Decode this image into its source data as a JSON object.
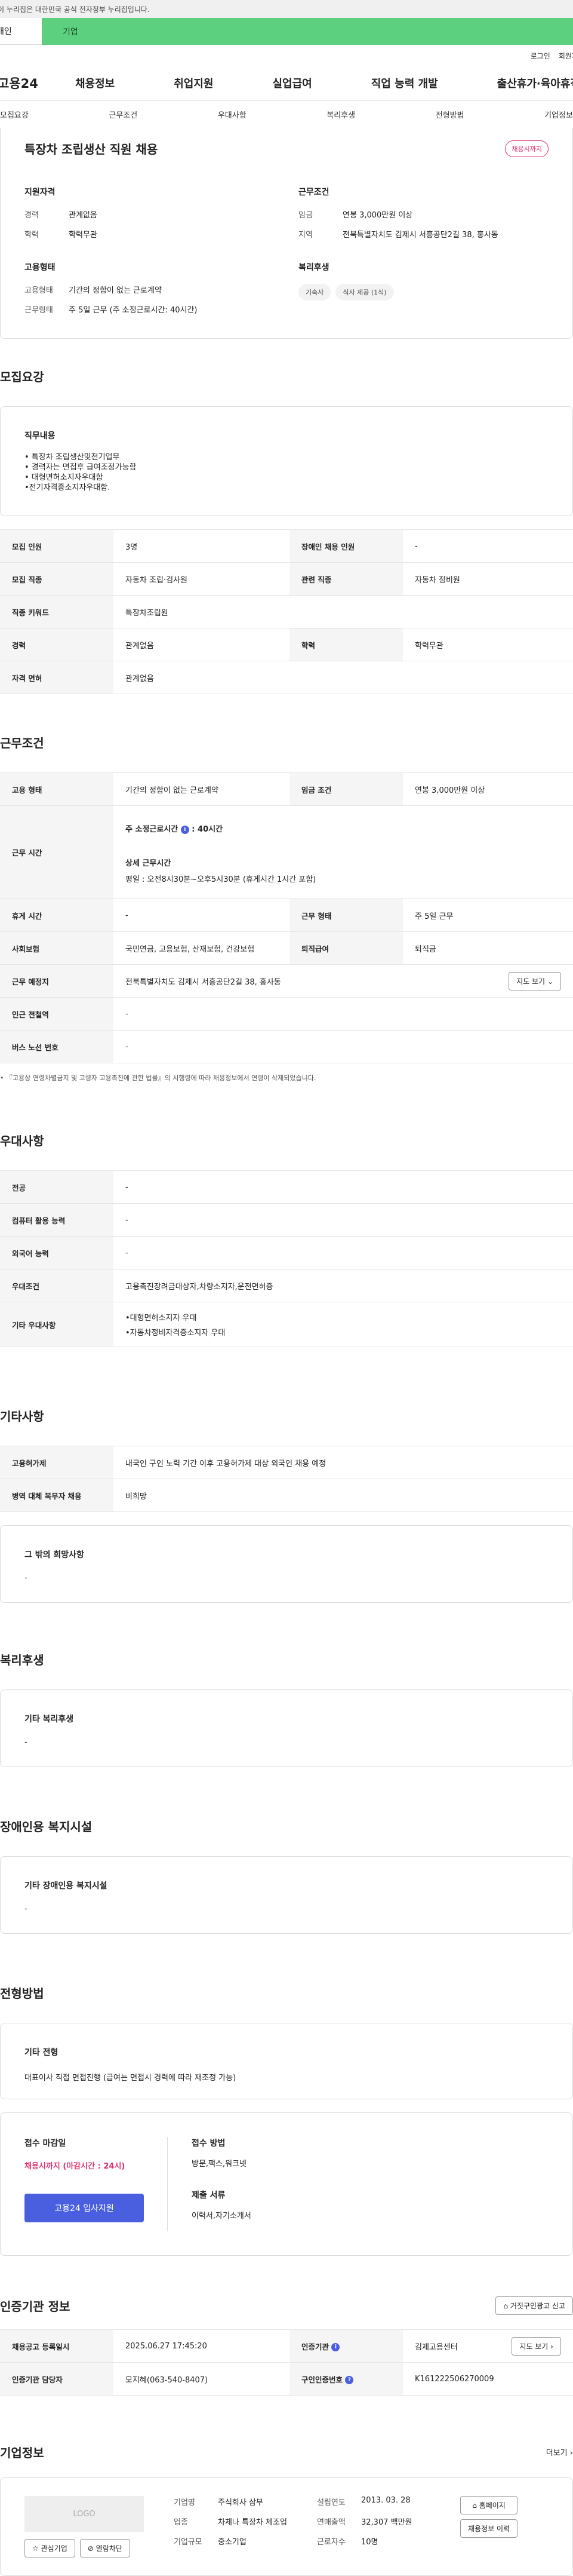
{
  "gov_banner": "이 누리집은 대한민국 공식 전자정부 누리집입니다.",
  "tabs": {
    "personal": "개인",
    "company": "기업"
  },
  "util": [
    "로그인",
    "회원가입"
  ],
  "logo": "고용24",
  "gnb": [
    "채용정보",
    "취업지원",
    "실업급여",
    "직업 능력 개발",
    "출산휴가·육아휴직"
  ],
  "anchor": [
    "모집요강",
    "근무조건",
    "우대사항",
    "복리후생",
    "전형방법",
    "기업정보"
  ],
  "job": {
    "title": "특장차 조립생산 직원 채용",
    "badge": "채용시까지",
    "qual": {
      "h": "지원자격",
      "exp_k": "경력",
      "exp_v": "관계없음",
      "edu_k": "학력",
      "edu_v": "학력무관"
    },
    "cond": {
      "h": "근무조건",
      "pay_k": "임금",
      "pay_v": "연봉 3,000만원 이상",
      "loc_k": "지역",
      "loc_v": "전북특별자치도 김제시 서흥공단2길 38, 홍사동"
    },
    "emp": {
      "h": "고용형태",
      "type_k": "고용형태",
      "type_v": "기간의 정함이 없는 근로계약",
      "form_k": "근무형태",
      "form_v": "주 5일 근무 (주 소정근로시간: 40시간)"
    },
    "welfare": {
      "h": "복리후생",
      "chips": [
        "기숙사",
        "식사 제공 (1식)"
      ]
    }
  },
  "recruit": {
    "title": "모집요강",
    "duty_h": "직무내용",
    "duty": [
      "• 특장차 조립생산및전기업무",
      "• 경력자는 면접후 급여조정가능함",
      "• 대형면허소지자우대함",
      "•전기자격증소지자우대함."
    ],
    "rows": [
      [
        "모집 인원",
        "3명",
        "장애인 채용 인원",
        "-"
      ],
      [
        "모집 직종",
        "자동차 조립·검사원",
        "관련 직종",
        "자동차 정비원"
      ],
      [
        "직종 키워드",
        "특장차조립원"
      ],
      [
        "경력",
        "관계없음",
        "학력",
        "학력무관"
      ],
      [
        "자격 면허",
        "관계없음"
      ]
    ]
  },
  "work": {
    "title": "근무조건",
    "r1": [
      "고용 형태",
      "기간의 정함이 없는 근로계약",
      "임금 조건",
      "연봉 3,000만원 이상"
    ],
    "hours_k": "근무 시간",
    "hours_main": "주 소정근로시간",
    "hours_val": "40시간",
    "hours_detail_h": "상세 근무시간",
    "hours_detail": "평일 : 오전8시30분~오후5시30분 (휴게시간 1시간 포함)",
    "r2": [
      "휴게 시간",
      "-",
      "근무 형태",
      "주 5일 근무"
    ],
    "r3": [
      "사회보험",
      "국민연금, 고용보험, 산재보험, 건강보험",
      "퇴직급여",
      "퇴직금"
    ],
    "place_k": "근무 예정지",
    "place_v": "전북특별자치도 김제시 서흥공단2길 38, 홍사동",
    "map_btn": "지도 보기",
    "r4": [
      "인근 전철역",
      "-"
    ],
    "r5": [
      "버스 노선 번호",
      "-"
    ],
    "note": "『고용상 연령차별금지 및 고령자 고용촉진에 관한 법률』의 시행령에 따라 채용정보에서 연령이 삭제되었습니다."
  },
  "pref": {
    "title": "우대사항",
    "rows": [
      [
        "전공",
        "-"
      ],
      [
        "컴퓨터 활용 능력",
        "-"
      ],
      [
        "외국어 능력",
        "-"
      ],
      [
        "우대조건",
        "고용촉진장려금대상자,차량소지자,운전면허증"
      ],
      [
        "기타 우대사항",
        "•대형면허소지자 우대",
        "•자동차정비자격증소지자 우대"
      ]
    ]
  },
  "etc": {
    "title": "기타사항",
    "rows": [
      [
        "고용허가제",
        "내국인 구인 노력 기간 이후 고용허가제 대상 외국인 채용 예정"
      ],
      [
        "병역 대체 복무자 채용",
        "비희망"
      ]
    ],
    "hope_h": "그 밖의 희망사항",
    "hope_v": "-"
  },
  "benefit": {
    "title": "복리후생",
    "h": "기타 복리후생",
    "v": "-"
  },
  "disab": {
    "title": "장애인용 복지시설",
    "h": "기타 장애인용 복지시설",
    "v": "-"
  },
  "select": {
    "title": "전형방법",
    "h": "기타 전형",
    "v": "대표이사 직접 면접진행 (급여는 면접시 경력에 따라 재조정 가능)",
    "deadline_h": "접수 마감일",
    "deadline_v": "채용시까지 (마감시간 : 24시)",
    "apply_btn": "고용24 입사지원",
    "method_h": "접수 방법",
    "method_v": "방문,팩스,워크넷",
    "docs_h": "제출 서류",
    "docs_v": "이력서,자기소개서"
  },
  "cert": {
    "title": "인증기관 정보",
    "report_btn": "거짓구인광고 신고",
    "r1": [
      "채용공고 등록일시",
      "2025.06.27 17:45:20",
      "인증기관",
      "김제고용센터"
    ],
    "map_btn": "지도 보기",
    "r2": [
      "인증기관 담당자",
      "모지혜(063-540-8407)",
      "구인인증번호",
      "K161222506270009"
    ]
  },
  "corp": {
    "title": "기업정보",
    "more": "더보기",
    "logo": "LOGO",
    "fav": "관심기업",
    "block": "열람차단",
    "k1": "기업명",
    "v1": "주식회사 삼부",
    "k2": "업종",
    "v2": "차체나 특장차 제조업",
    "k3": "기업규모",
    "v3": "중소기업",
    "k4": "설립연도",
    "v4": "2013. 03. 28",
    "k5": "연매출액",
    "v5": "32,307 백만원",
    "k6": "근로자수",
    "v6": "10명",
    "home": "홈페이지",
    "jobs": "채용정보 이력"
  }
}
